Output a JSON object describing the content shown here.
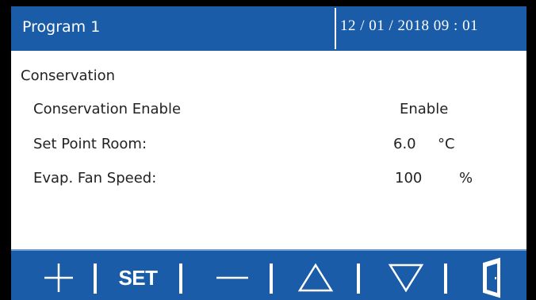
{
  "header": {
    "title": "Program 1",
    "datetime": "12 / 01 / 2018  09 : 01"
  },
  "content": {
    "section_title": "Conservation",
    "rows": [
      {
        "label": "Conservation Enable",
        "value": "Enable",
        "unit": ""
      },
      {
        "label": "Set Point Room:",
        "value": "6.0",
        "unit": "°C"
      },
      {
        "label": "Evap. Fan Speed:",
        "value": "100",
        "unit": "%"
      }
    ]
  },
  "toolbar": {
    "set_label": "SET",
    "buttons": [
      "plus-icon",
      "set-button",
      "minus-icon",
      "arrow-up-icon",
      "arrow-down-icon",
      "door-exit-icon"
    ]
  },
  "colors": {
    "bar_blue": "#1a5ca8",
    "background": "#ffffff",
    "text": "#222222",
    "bezel": "#000000"
  }
}
